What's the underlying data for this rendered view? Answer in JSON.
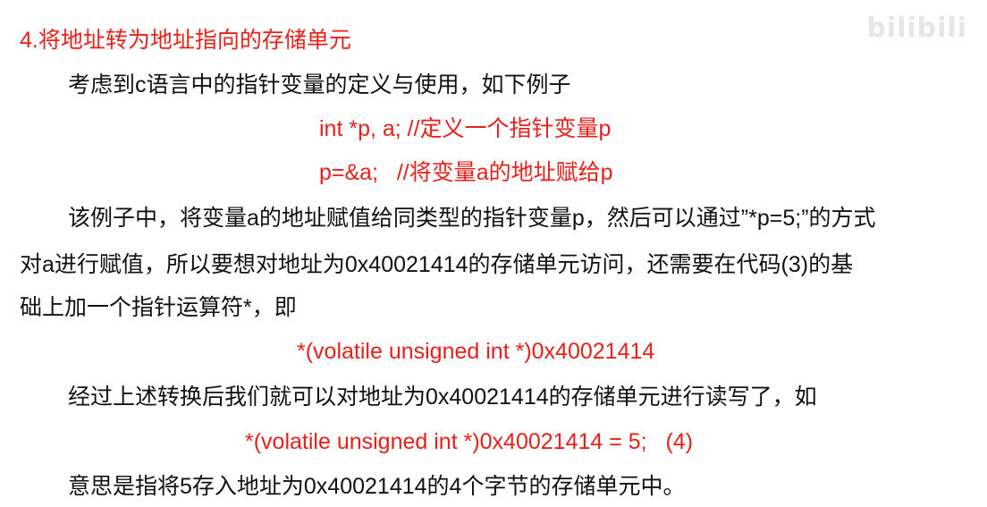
{
  "watermark": "bilibili",
  "colors": {
    "accent_red": "#e8201a",
    "text": "#111111"
  },
  "heading": "4.将地址转为地址指向的存储单元",
  "para1": "考虑到c语言中的指针变量的定义与使用，如下例子",
  "code1": "int *p, a; //定义一个指针变量p",
  "code2": "p=&a;   //将变量a的地址赋给p",
  "para2_lines": [
    "该例子中，将变量a的地址赋值给同类型的指针变量p，然后可以通过”*p=5;”的方式",
    "对a进行赋值，所以要想对地址为0x40021414的存储单元访问，还需要在代码(3)的基",
    "础上加一个指针运算符*，即"
  ],
  "code3": "*(volatile unsigned int *)0x40021414",
  "para3": "经过上述转换后我们就可以对地址为0x40021414的存储单元进行读写了，如",
  "code4": "*(volatile unsigned int *)0x40021414 = 5;   (4)",
  "para4": "意思是指将5存入地址为0x40021414的4个字节的存储单元中。"
}
